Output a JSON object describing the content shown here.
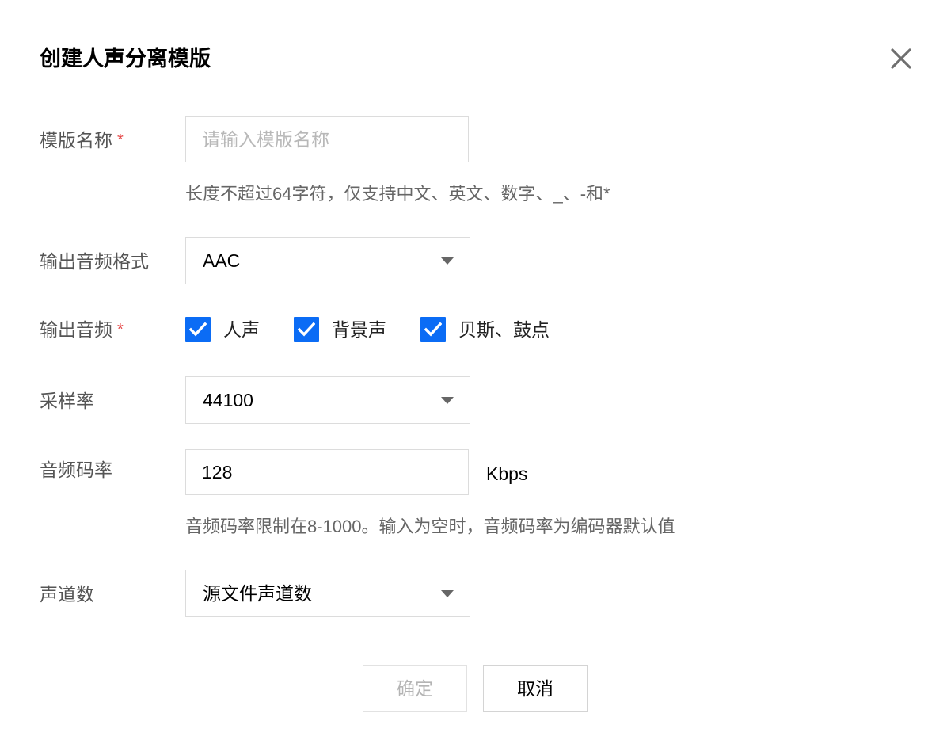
{
  "dialog": {
    "title": "创建人声分离模版",
    "close_icon": "close-icon"
  },
  "form": {
    "template_name": {
      "label": "模版名称",
      "required_mark": "*",
      "value": "",
      "placeholder": "请输入模版名称",
      "hint": "长度不超过64字符，仅支持中文、英文、数字、_、-和*"
    },
    "output_format": {
      "label": "输出音频格式",
      "value": "AAC"
    },
    "output_audio": {
      "label": "输出音频",
      "required_mark": "*",
      "options": [
        {
          "label": "人声",
          "checked": true
        },
        {
          "label": "背景声",
          "checked": true
        },
        {
          "label": "贝斯、鼓点",
          "checked": true
        }
      ]
    },
    "sample_rate": {
      "label": "采样率",
      "value": "44100"
    },
    "bitrate": {
      "label": "音频码率",
      "value": "128",
      "unit": "Kbps",
      "hint": "音频码率限制在8-1000。输入为空时，音频码率为编码器默认值"
    },
    "channels": {
      "label": "声道数",
      "value": "源文件声道数"
    }
  },
  "buttons": {
    "confirm": "确定",
    "cancel": "取消"
  },
  "colors": {
    "checkbox_accent": "#0b6cf5",
    "required": "#e54545",
    "disabled_text": "#b4b4b4"
  }
}
